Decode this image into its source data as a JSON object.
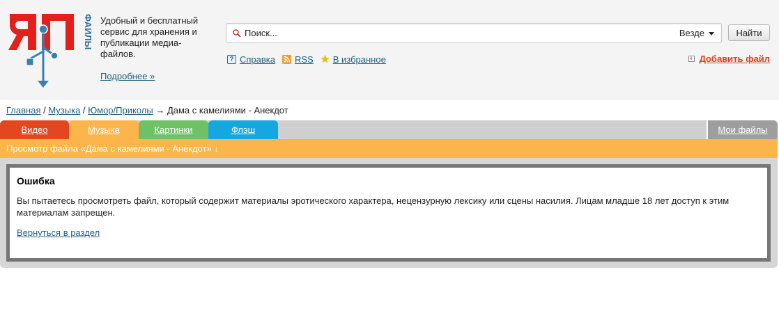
{
  "header": {
    "logo_alt": "ЯП ФАЙЛЫ",
    "tagline": "Удобный и бесплатный сервис для хранения и публикации медиа-файлов.",
    "more_link": "Подробнее »"
  },
  "search": {
    "placeholder": "Поиск...",
    "scope": "Везде",
    "button_label": "Найти"
  },
  "toplinks": {
    "help": "Справка",
    "rss": "RSS",
    "favorites": "В избранное",
    "add_file": "Добавить файл"
  },
  "breadcrumb": {
    "home": "Главная",
    "sep1": " / ",
    "music": "Музыка",
    "sep2": " / ",
    "humor": "Юмор/Приколы",
    "arrow": " → ",
    "current": "Дама с камелиями - Анекдот"
  },
  "tabs": {
    "video": "Видео",
    "music": "Музыка",
    "pictures": "Картинки",
    "flash": "Флэш",
    "my_files": "Мои файлы"
  },
  "subbar": {
    "title": "Просмотр файла «Дама с камелиями - Анекдот» ↓"
  },
  "error": {
    "title": "Ошибка",
    "message": "Вы пытаетесь просмотреть файл, который содержит материалы эротического характера, нецензурную лексику или сцены насилия. Лицам младше 18 лет доступ к этим материалам запрещен.",
    "back_link": "Вернуться в раздел"
  },
  "colors": {
    "video_tab": "#e3471f",
    "music_tab": "#fbb54a",
    "pictures_tab": "#6ec166",
    "flash_tab": "#17a7e0",
    "add_file_link": "#d8401f"
  }
}
